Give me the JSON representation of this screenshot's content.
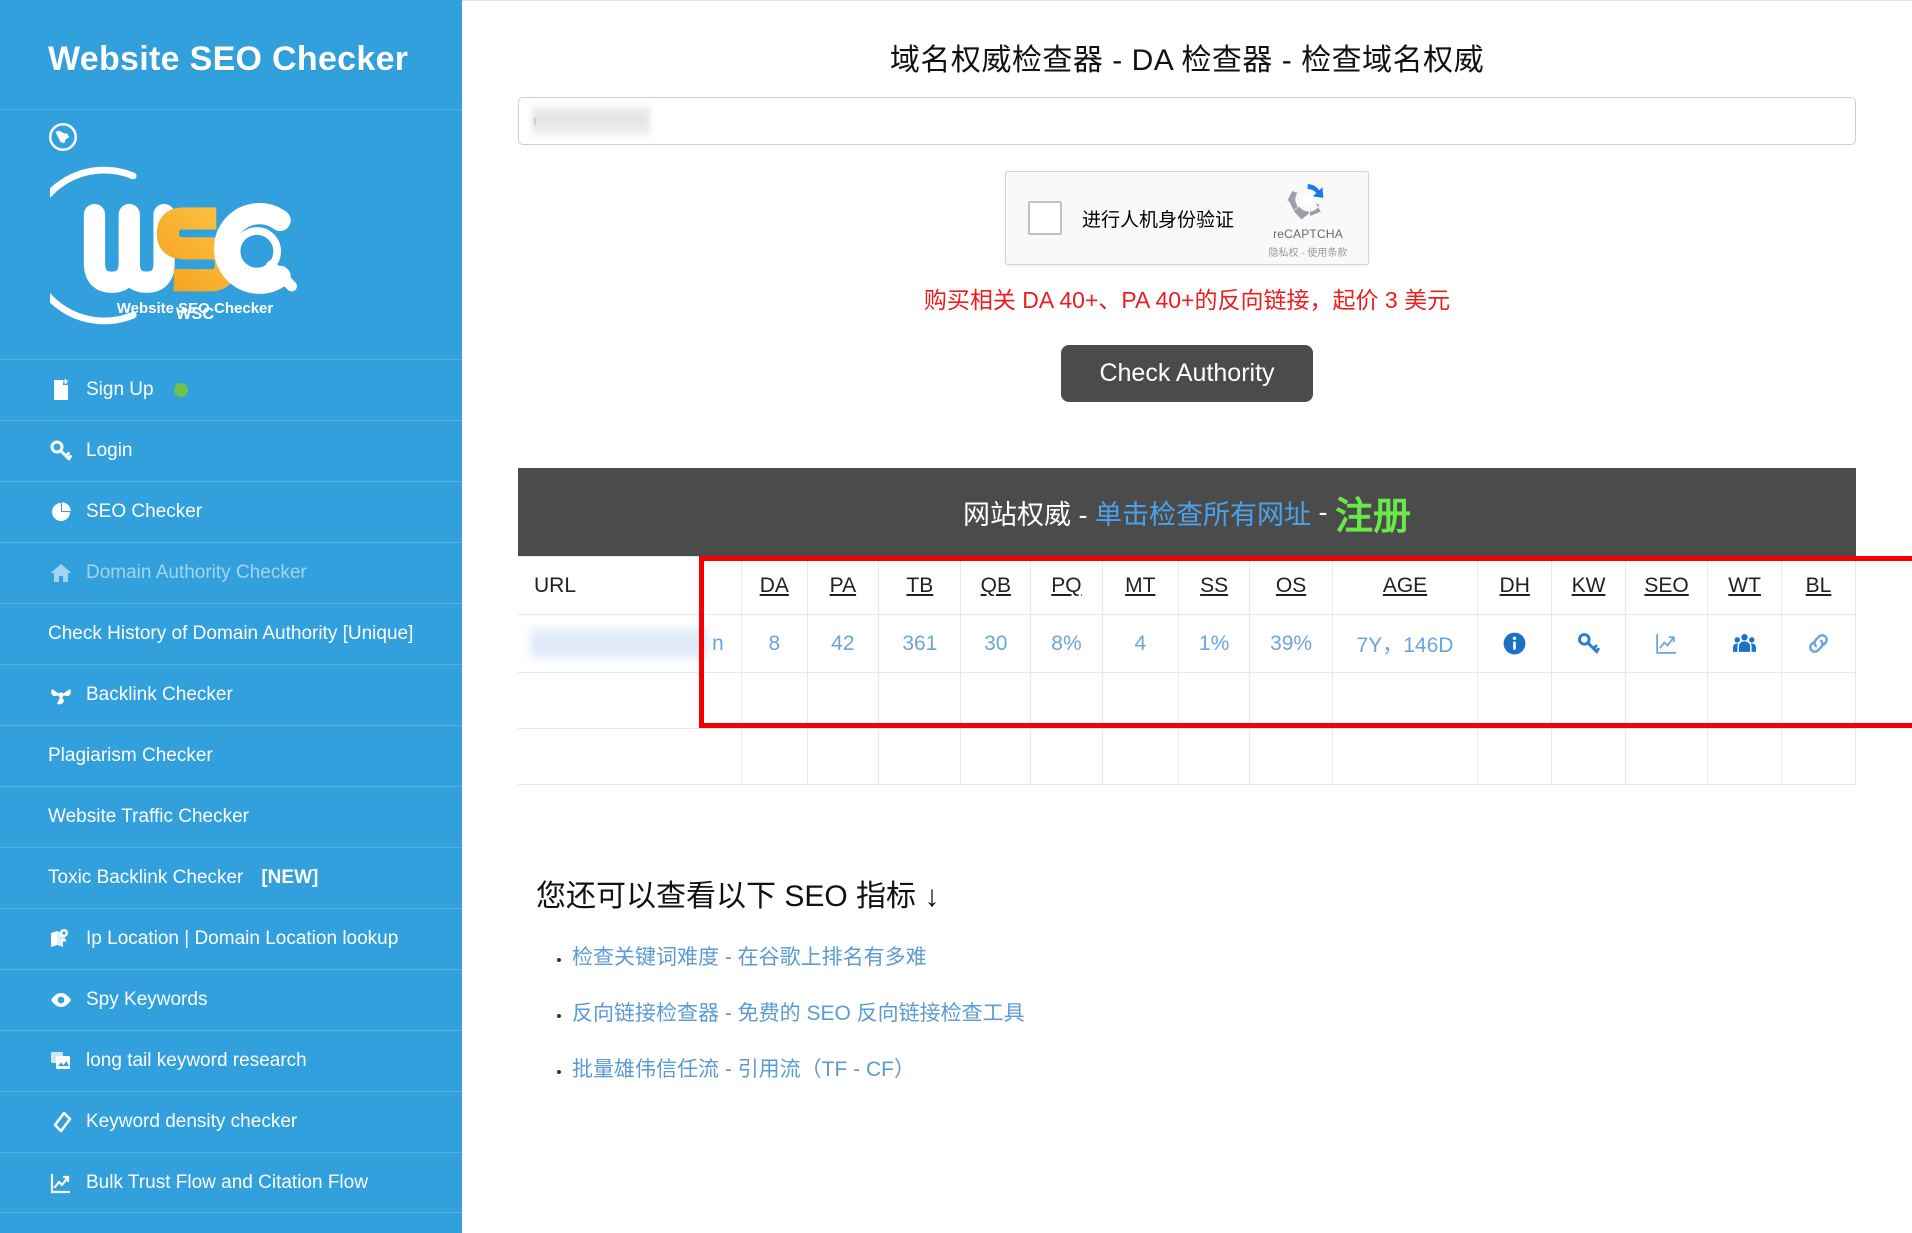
{
  "sidebar": {
    "title": "Website SEO Checker",
    "logo_caption": "Website SEO Checker",
    "logo_text": "WSC",
    "items": [
      {
        "label": "Sign Up",
        "icon": "signup-page-icon",
        "dot": true,
        "dim": false
      },
      {
        "label": "Login",
        "icon": "key-icon",
        "dim": false
      },
      {
        "label": "SEO Checker",
        "icon": "pie-chart-icon",
        "dim": false
      },
      {
        "label": "Domain Authority Checker",
        "icon": "home-icon",
        "dim": true
      },
      {
        "label": "Check History of Domain Authority [Unique]",
        "icon": "none",
        "dim": false
      },
      {
        "label": "Backlink Checker",
        "icon": "backlink-icon",
        "dim": false
      },
      {
        "label": "Plagiarism Checker",
        "icon": "none",
        "dim": false
      },
      {
        "label": "Website Traffic Checker",
        "icon": "none",
        "dim": false
      },
      {
        "label": "Toxic Backlink Checker",
        "badge": "[NEW]",
        "icon": "none",
        "dim": false
      },
      {
        "label": "Ip Location | Domain Location lookup",
        "icon": "map-pin-icon",
        "dim": false
      },
      {
        "label": "Spy Keywords",
        "icon": "eye-icon",
        "dim": false
      },
      {
        "label": "long tail keyword research",
        "icon": "cards-icon",
        "dim": false
      },
      {
        "label": "Keyword density checker",
        "icon": "tag-icon",
        "dim": false
      },
      {
        "label": "Bulk Trust Flow and Citation Flow",
        "icon": "line-chart-icon",
        "dim": false
      }
    ]
  },
  "main": {
    "page_title": "域名权威检查器 - DA 检查器 - 检查域名权威",
    "url_input": {
      "value": "om",
      "placeholder": ""
    },
    "captcha": {
      "checkbox_label": "进行人机身份验证",
      "brand_name": "reCAPTCHA",
      "legal": "隐私权 - 使用条款"
    },
    "promo_text": "购买相关 DA 40+、PA 40+的反向链接，起价 3 美元",
    "submit_label": "Check Authority"
  },
  "result": {
    "banner": {
      "part1": "网站权威 - ",
      "part2": "单击检查所有网址",
      "sep": " - ",
      "part3": "注册"
    },
    "columns": [
      {
        "key": "url",
        "label": "URL",
        "underline": false
      },
      {
        "key": "da",
        "label": "DA",
        "underline": true
      },
      {
        "key": "pa",
        "label": "PA",
        "underline": true
      },
      {
        "key": "tb",
        "label": "TB",
        "underline": true
      },
      {
        "key": "qb",
        "label": "QB",
        "underline": true
      },
      {
        "key": "pq",
        "label": "PQ",
        "underline": true
      },
      {
        "key": "mt",
        "label": "MT",
        "underline": true
      },
      {
        "key": "ss",
        "label": "SS",
        "underline": true
      },
      {
        "key": "os",
        "label": "OS",
        "underline": true
      },
      {
        "key": "age",
        "label": "AGE",
        "underline": true
      },
      {
        "key": "dh",
        "label": "DH",
        "underline": true
      },
      {
        "key": "kw",
        "label": "KW",
        "underline": true
      },
      {
        "key": "seo",
        "label": "SEO",
        "underline": true
      },
      {
        "key": "wt",
        "label": "WT",
        "underline": true
      },
      {
        "key": "bl",
        "label": "BL",
        "underline": true
      }
    ],
    "row": {
      "url": "n",
      "da": "8",
      "pa": "42",
      "tb": "361",
      "qb": "30",
      "pq": "8%",
      "mt": "4",
      "ss": "1%",
      "os": "39%",
      "age": "7Y，146D",
      "dh_icon": "info-icon",
      "kw_icon": "key-icon",
      "seo_icon": "line-chart-icon",
      "wt_icon": "users-icon",
      "bl_icon": "link-icon"
    },
    "highlight_color": "#f50000"
  },
  "extra": {
    "title": "您还可以查看以下 SEO 指标 ↓",
    "links": [
      "检查关键词难度 - 在谷歌上排名有多难",
      "反向链接检查器 - 免费的 SEO 反向链接检查工具",
      "批量雄伟信任流 - 引用流（TF - CF）"
    ]
  },
  "colors": {
    "sidebar_bg": "#31a0dd",
    "dark_bar": "#4b4b4b",
    "link_blue": "#5b9bd5",
    "promo_red": "#ee1c1c",
    "green": "#69e84a"
  }
}
